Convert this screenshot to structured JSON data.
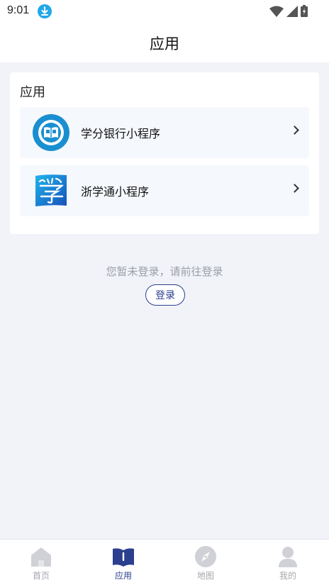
{
  "status_bar": {
    "time": "9:01"
  },
  "header": {
    "title": "应用"
  },
  "card": {
    "title": "应用",
    "items": [
      {
        "label": "学分银行小程序",
        "icon": "book-badge-icon"
      },
      {
        "label": "浙学通小程序",
        "icon": "xue-logo-icon"
      }
    ]
  },
  "login": {
    "hint": "您暂未登录，请前往登录",
    "button": "登录"
  },
  "tabs": [
    {
      "label": "首页",
      "icon": "home-icon"
    },
    {
      "label": "应用",
      "icon": "book-icon",
      "active": true
    },
    {
      "label": "地图",
      "icon": "compass-icon"
    },
    {
      "label": "我的",
      "icon": "user-icon"
    }
  ],
  "colors": {
    "accent": "#2b3f8e",
    "download_badge": "#1fa8ea",
    "inactive_tab": "#a4a7ad"
  }
}
